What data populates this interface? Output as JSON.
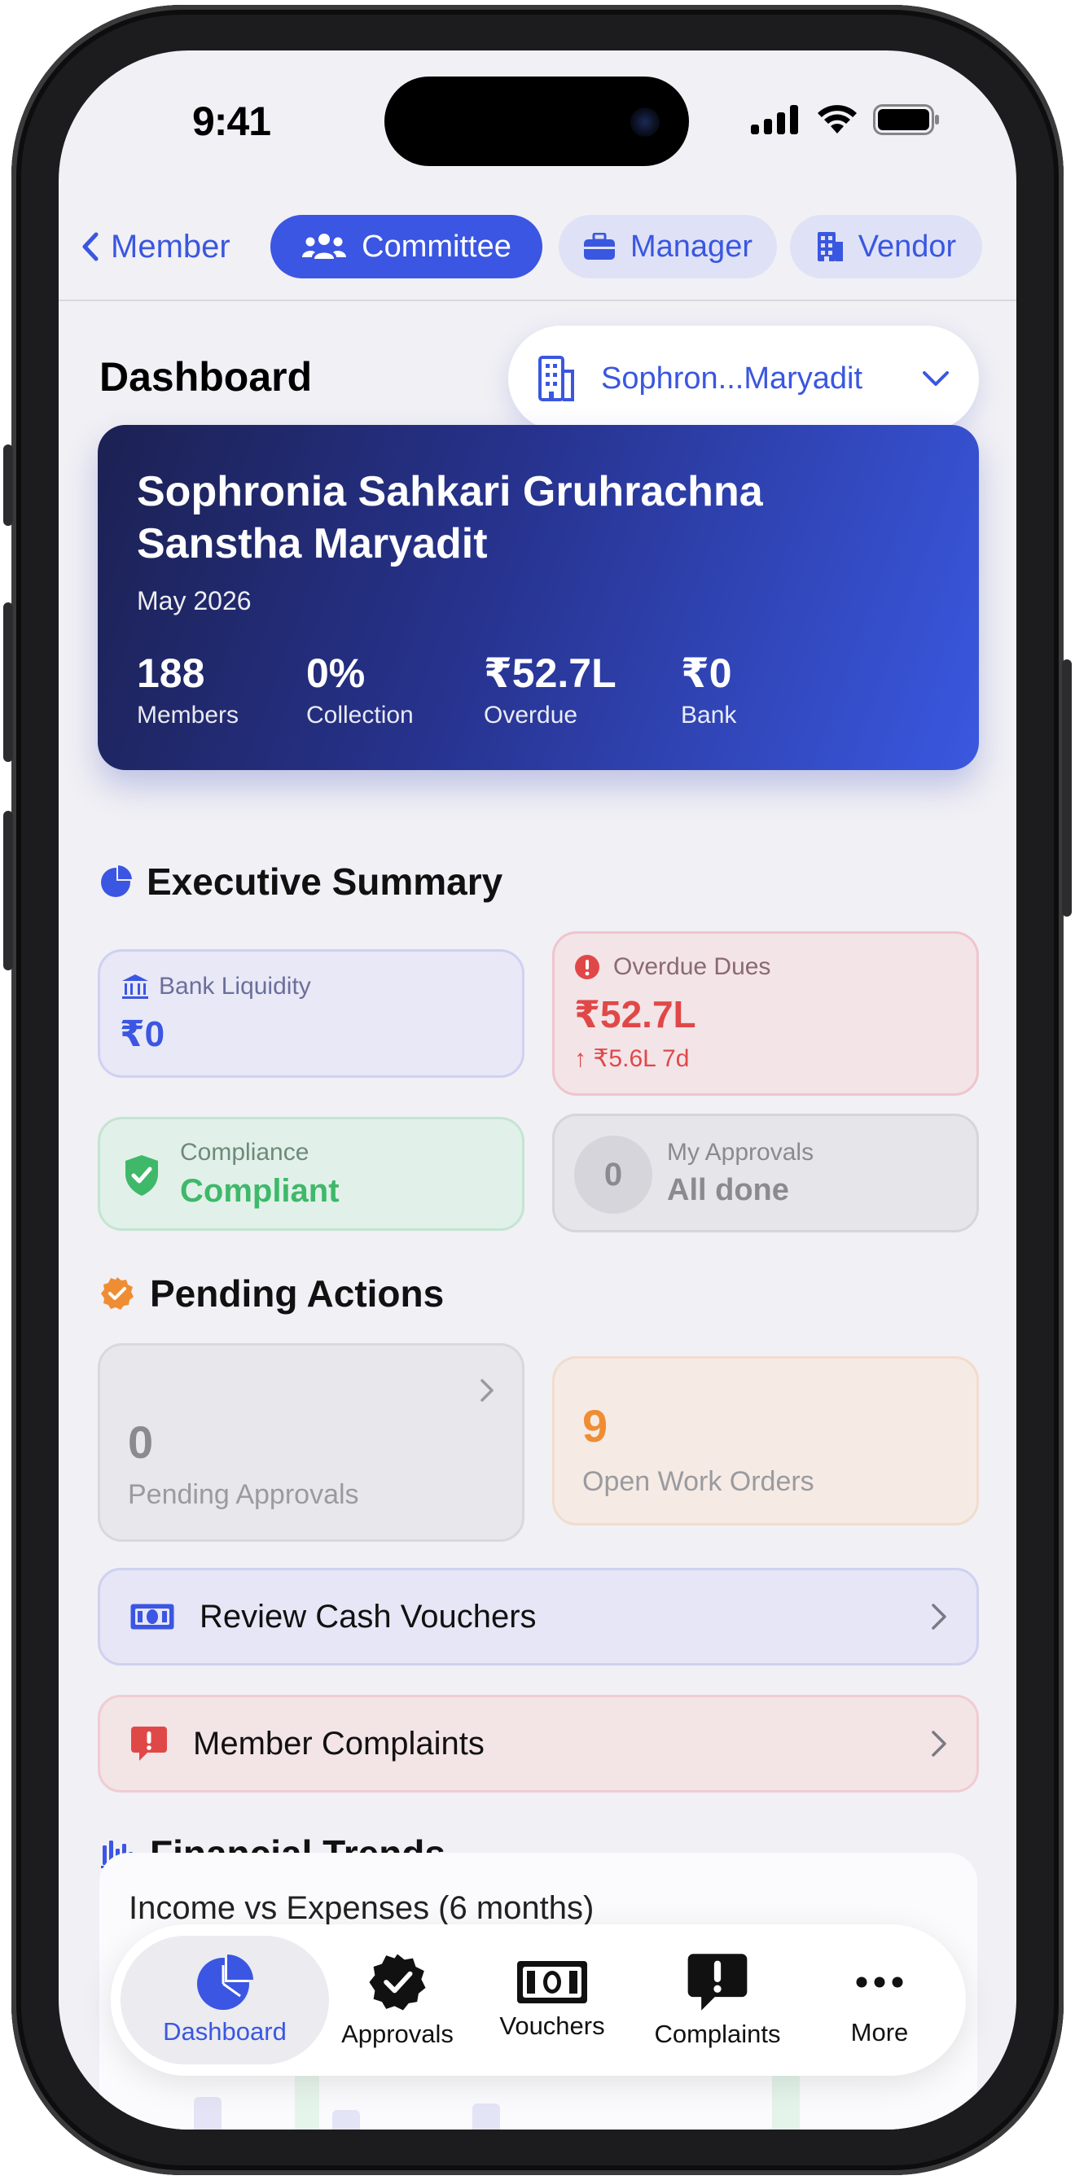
{
  "status_bar": {
    "time": "9:41"
  },
  "role_tabs": {
    "back_label": "Member",
    "items": [
      {
        "label": "Committee",
        "active": true
      },
      {
        "label": "Manager",
        "active": false
      },
      {
        "label": "Vendor",
        "active": false
      }
    ]
  },
  "header": {
    "title": "Dashboard",
    "society_selector": "Sophron...Maryadit"
  },
  "hero": {
    "society_name": "Sophronia Sahkari Gruhrachna Sanstha Maryadit",
    "period": "May 2026",
    "stats": [
      {
        "value": "188",
        "label": "Members"
      },
      {
        "value": "0%",
        "label": "Collection"
      },
      {
        "value": "₹52.7L",
        "label": "Overdue"
      },
      {
        "value": "₹0",
        "label": "Bank"
      }
    ]
  },
  "executive_summary": {
    "title": "Executive Summary",
    "bank_liquidity": {
      "label": "Bank Liquidity",
      "value": "₹0"
    },
    "overdue_dues": {
      "label": "Overdue Dues",
      "value": "₹52.7L",
      "delta": "↑ ₹5.6L 7d"
    },
    "compliance": {
      "label": "Compliance",
      "value": "Compliant"
    },
    "my_approvals": {
      "count": "0",
      "label": "My Approvals",
      "value": "All done"
    }
  },
  "pending_actions": {
    "title": "Pending Actions",
    "pending_approvals": {
      "count": "0",
      "label": "Pending Approvals"
    },
    "open_work_orders": {
      "count": "9",
      "label": "Open Work Orders"
    },
    "review_cash_vouchers": "Review Cash Vouchers",
    "member_complaints": "Member Complaints"
  },
  "financial_trends": {
    "title": "Financial Trends",
    "chart_title": "Income vs Expenses (6 months)"
  },
  "bottom_nav": {
    "items": [
      {
        "label": "Dashboard",
        "icon": "pie-chart-icon",
        "active": true
      },
      {
        "label": "Approvals",
        "icon": "checkmark-seal-icon",
        "active": false
      },
      {
        "label": "Vouchers",
        "icon": "banknote-icon",
        "active": false
      },
      {
        "label": "Complaints",
        "icon": "exclamation-bubble-icon",
        "active": false
      },
      {
        "label": "More",
        "icon": "ellipsis-icon",
        "active": false
      }
    ]
  },
  "colors": {
    "accent": "#3b56e2",
    "danger": "#e04848",
    "success": "#3fb86a",
    "warning": "#ef8d34",
    "background": "#f1f0f5"
  }
}
